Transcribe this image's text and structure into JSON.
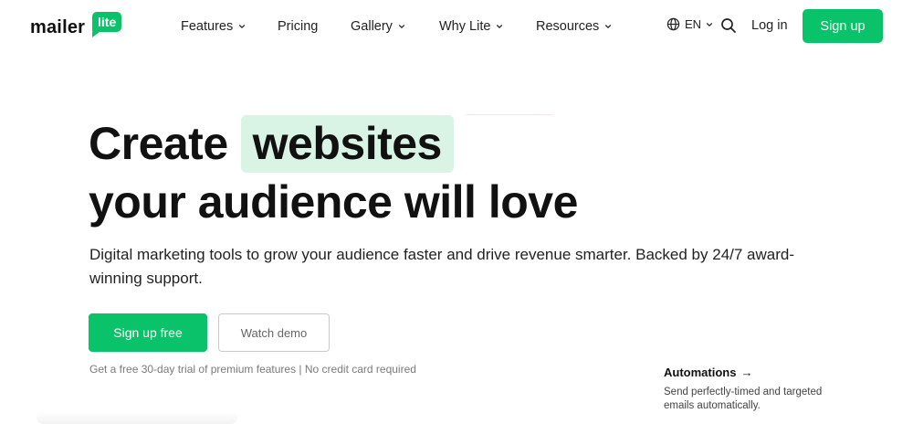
{
  "brand": {
    "name": "mailer",
    "badge": "lite",
    "accent_color": "#09c269",
    "highlight_color": "#d9f3e5"
  },
  "nav": {
    "items": [
      {
        "label": "Features",
        "has_dropdown": true,
        "icon": "chevron-down-icon"
      },
      {
        "label": "Pricing",
        "has_dropdown": false
      },
      {
        "label": "Gallery",
        "has_dropdown": true,
        "icon": "chevron-down-icon"
      },
      {
        "label": "Why Lite",
        "has_dropdown": true,
        "icon": "chevron-down-icon"
      },
      {
        "label": "Resources",
        "has_dropdown": true,
        "icon": "chevron-down-icon"
      }
    ],
    "language": {
      "label": "EN",
      "icon": "globe-icon"
    },
    "search_icon": "search-icon",
    "login_label": "Log in",
    "signup_label": "Sign up"
  },
  "hero": {
    "title_prefix": "Create",
    "title_highlight": "websites",
    "title_line2": "your audience will love",
    "subtitle": "Digital marketing tools to grow your audience faster and drive revenue smarter. Backed by 24/7 award-winning support.",
    "cta_primary": "Sign up free",
    "cta_secondary": "Watch demo",
    "note": "Get a free 30-day trial of premium features | No credit card required"
  },
  "feature": {
    "title": "Automations",
    "arrow": "→",
    "description": "Send perfectly-timed and targeted emails automatically."
  }
}
